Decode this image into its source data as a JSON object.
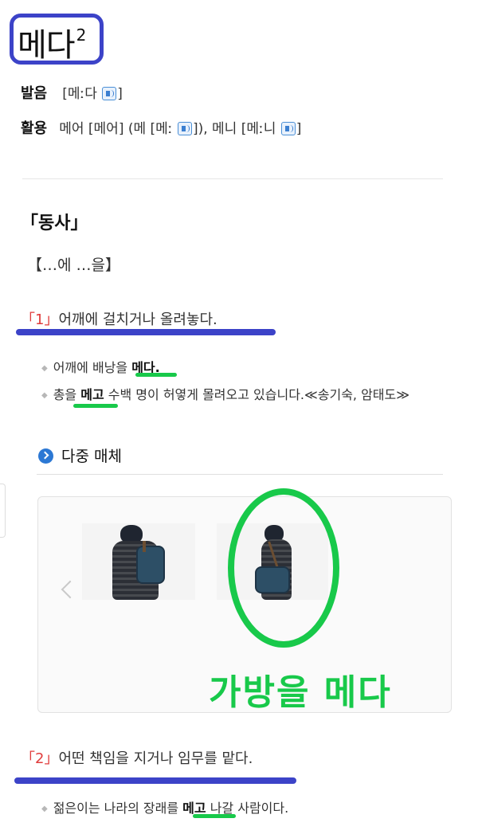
{
  "entry": {
    "headword": "메다",
    "homonym_number": "2"
  },
  "pronunciation": {
    "label": "발음",
    "bracket_open": "[",
    "text": "메ː다",
    "bracket_close": "]"
  },
  "conjugation": {
    "label": "활용",
    "text_1": "메어 [메어] (메 [메ː",
    "text_2": "]), 메니 [메ː니",
    "text_3": "]"
  },
  "pos": "「동사」",
  "pattern": "【…에 …을】",
  "senses": [
    {
      "number": "「1」",
      "definition": "어깨에 걸치거나 올려놓다.",
      "examples": [
        {
          "before": "어깨에 배낭을 ",
          "bold": "메다.",
          "after": ""
        },
        {
          "before": "총을 ",
          "bold": "메고",
          "after": " 수백 명이 허옇게 몰려오고 있습니다.≪송기숙, 암태도≫"
        }
      ]
    },
    {
      "number": "「2」",
      "definition": "어떤 책임을 지거나 임무를 맡다.",
      "examples": [
        {
          "before": "젊은이는 나라의 장래를 ",
          "bold": "메고",
          "after": " 나갈 사람이다."
        }
      ]
    }
  ],
  "media": {
    "title": "다중 매체"
  },
  "annotation": {
    "caption": "가방을 메다"
  },
  "colors": {
    "highlight_blue": "#3c43c8",
    "highlight_green": "#18c94a",
    "sense_number_red": "#e03c3c"
  },
  "icons": [
    "speaker-icon",
    "chevron-right-circle-icon",
    "chevron-left-icon"
  ]
}
